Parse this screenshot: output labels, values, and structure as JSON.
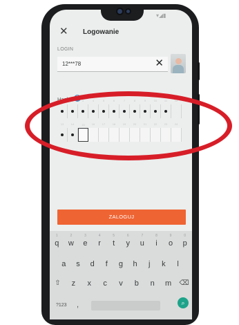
{
  "header": {
    "title": "Logowanie",
    "close_icon": "close-icon"
  },
  "login": {
    "label": "LOGIN",
    "value": "12***78",
    "clear_icon": "clear-icon"
  },
  "password": {
    "label": "Hasło",
    "info_icon": "?",
    "cells_row1": [
      "1",
      "2",
      "3",
      "4",
      "5",
      "6",
      "7",
      "8",
      "9",
      "10",
      "11",
      "12"
    ],
    "cells_row2": [
      "13",
      "14",
      "15",
      "16",
      "17",
      "18",
      "19",
      "20",
      "21",
      "22",
      "23",
      "24"
    ]
  },
  "submit": {
    "label": "ZALOGUJ"
  },
  "keyboard": {
    "row1": [
      "q",
      "w",
      "e",
      "r",
      "t",
      "y",
      "u",
      "i",
      "o",
      "p"
    ],
    "row1_sup": [
      "1",
      "2",
      "3",
      "4",
      "5",
      "6",
      "7",
      "8",
      "9",
      "0"
    ],
    "row2": [
      "a",
      "s",
      "d",
      "f",
      "g",
      "h",
      "j",
      "k",
      "l"
    ],
    "row3": [
      "z",
      "x",
      "c",
      "v",
      "b",
      "n",
      "m"
    ],
    "shift_icon": "⇧",
    "backspace_icon": "⌫",
    "mode_label": "?123",
    "comma": ",",
    "go_icon": "⌕"
  },
  "colors": {
    "accent": "#ef6433",
    "annotation": "#d71e28",
    "info": "#3f89c3",
    "keyboard_action": "#1da38a"
  }
}
